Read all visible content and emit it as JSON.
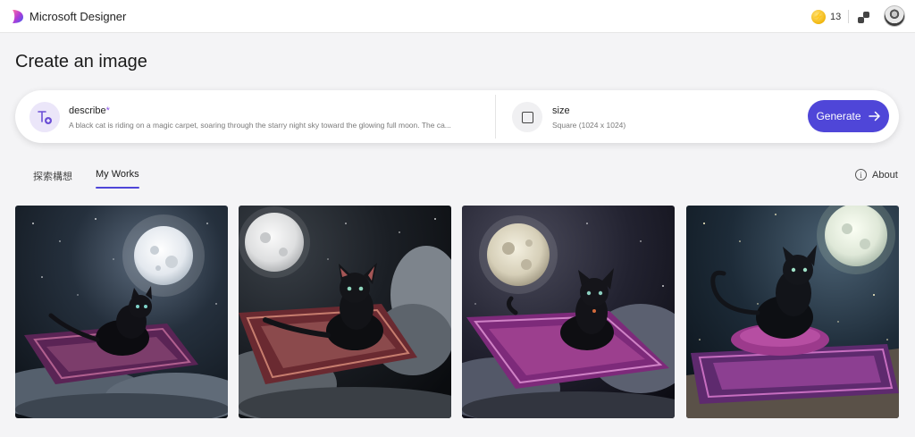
{
  "header": {
    "app_name": "Microsoft Designer",
    "credits": "13",
    "icons": {
      "logo": "designer-logo",
      "coin": "boost-coin-icon",
      "apps": "apps-switch-icon",
      "avatar": "user-avatar"
    }
  },
  "page": {
    "title": "Create an image"
  },
  "prompt": {
    "describe_label": "describe",
    "required_mark": "*",
    "describe_value": "A black cat is riding on a magic carpet, soaring through the starry night sky toward the glowing full moon. The ca...",
    "size_label": "size",
    "size_value": "Square (1024 x 1024)",
    "generate_label": "Generate"
  },
  "tabs": [
    {
      "label": "探索構想",
      "active": false
    },
    {
      "label": "My Works",
      "active": true
    }
  ],
  "about_label": "About",
  "accent_color": "#4f46d8",
  "images": [
    {
      "name": "cat-on-carpet-1"
    },
    {
      "name": "cat-on-carpet-2"
    },
    {
      "name": "cat-on-carpet-3"
    },
    {
      "name": "cat-on-carpet-4"
    }
  ]
}
